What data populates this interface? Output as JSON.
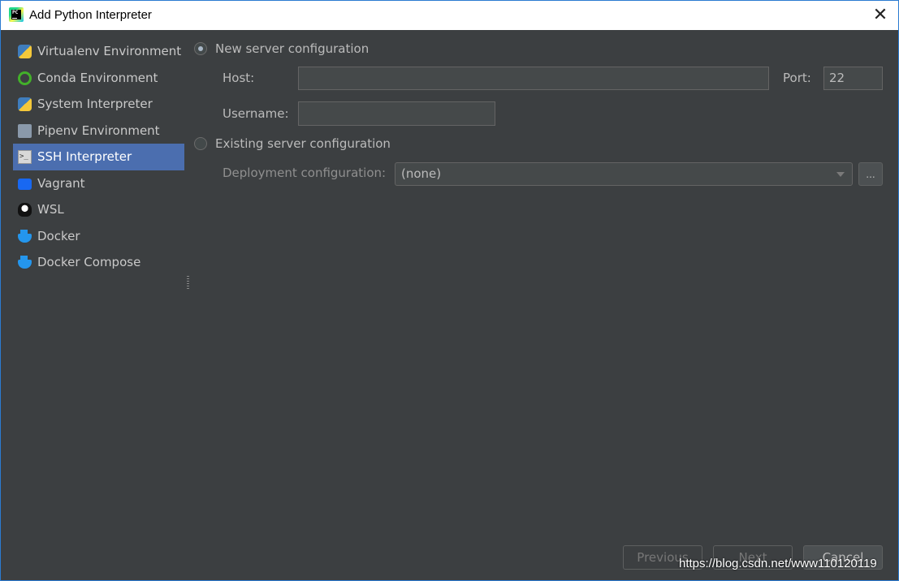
{
  "window": {
    "title": "Add Python Interpreter",
    "close_glyph": "✕",
    "app_icon_text": "PC"
  },
  "sidebar": {
    "items": [
      {
        "label": "Virtualenv Environment",
        "icon": "python-icon",
        "selected": false
      },
      {
        "label": "Conda Environment",
        "icon": "conda-icon",
        "selected": false
      },
      {
        "label": "System Interpreter",
        "icon": "python-icon",
        "selected": false
      },
      {
        "label": "Pipenv Environment",
        "icon": "pipenv-icon",
        "selected": false
      },
      {
        "label": "SSH Interpreter",
        "icon": "terminal-icon",
        "selected": true
      },
      {
        "label": "Vagrant",
        "icon": "vagrant-icon",
        "selected": false
      },
      {
        "label": "WSL",
        "icon": "linux-penguin-icon",
        "selected": false
      },
      {
        "label": "Docker",
        "icon": "docker-icon",
        "selected": false
      },
      {
        "label": "Docker Compose",
        "icon": "docker-icon",
        "selected": false
      }
    ]
  },
  "main": {
    "new_server": {
      "label": "New server configuration",
      "selected": true,
      "host_label": "Host:",
      "host_value": "",
      "port_label": "Port:",
      "port_value": "22",
      "username_label": "Username:",
      "username_value": ""
    },
    "existing_server": {
      "label": "Existing server configuration",
      "selected": false,
      "deployment_label": "Deployment configuration:",
      "deployment_value": "(none)",
      "browse_label": "..."
    }
  },
  "footer": {
    "previous_label": "Previous",
    "next_label": "Next",
    "cancel_label": "Cancel"
  },
  "watermark": "https://blog.csdn.net/www110120119",
  "colors": {
    "background": "#3c3f41",
    "selection": "#4b6eaf",
    "titlebar": "#ffffff",
    "window_border": "#2b7bd1"
  }
}
